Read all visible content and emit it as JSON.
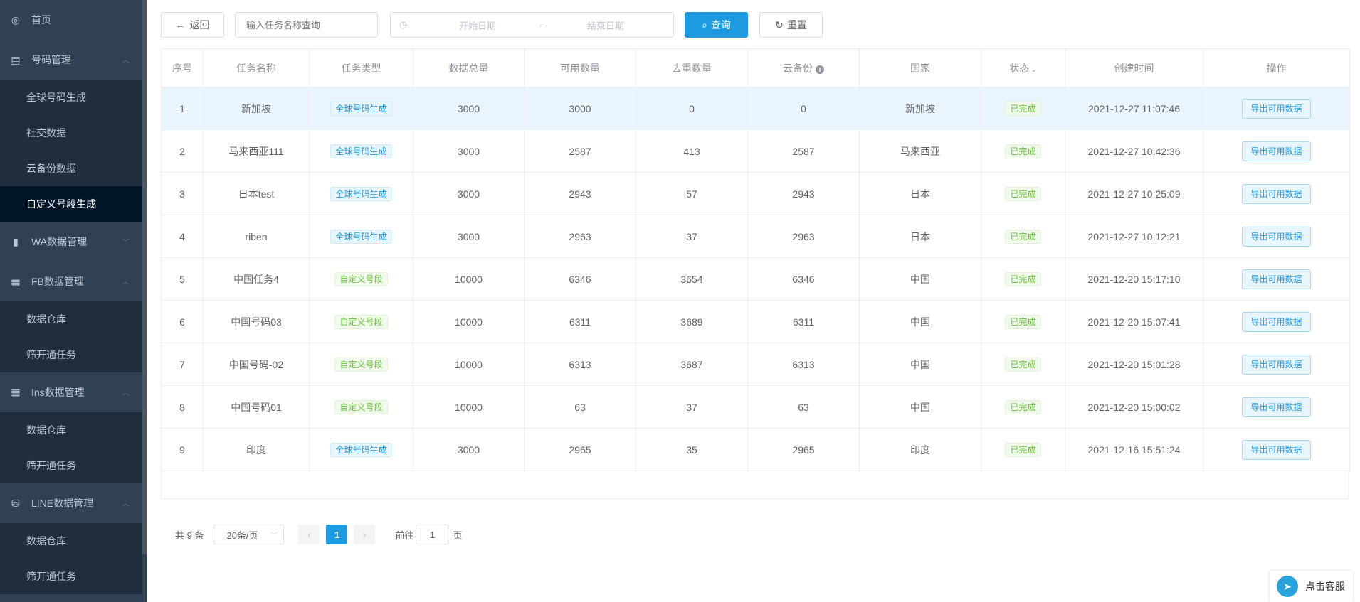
{
  "sidebar": {
    "home": "首页",
    "number_mgmt": "号码管理",
    "number_sub": [
      "全球号码生成",
      "社交数据",
      "云备份数据",
      "自定义号段生成"
    ],
    "wa_mgmt": "WA数据管理",
    "fb_mgmt": "FB数据管理",
    "fb_sub": [
      "数据仓库",
      "筛开通任务"
    ],
    "ins_mgmt": "Ins数据管理",
    "ins_sub": [
      "数据仓库",
      "筛开通任务"
    ],
    "line_mgmt": "LINE数据管理",
    "line_sub": [
      "数据仓库",
      "筛开通任务"
    ]
  },
  "toolbar": {
    "back_label": "返回",
    "search_placeholder": "输入任务名称查询",
    "start_date_placeholder": "开始日期",
    "date_separator": "-",
    "end_date_placeholder": "结束日期",
    "query_label": "查询",
    "reset_label": "重置"
  },
  "table": {
    "headers": [
      "序号",
      "任务名称",
      "任务类型",
      "数据总量",
      "可用数量",
      "去重数量",
      "云备份",
      "国家",
      "状态",
      "创建时间",
      "操作"
    ],
    "rows": [
      {
        "no": "1",
        "name": "新加坡",
        "type": "全球号码生成",
        "tcolor": "blue",
        "total": "3000",
        "avail": "3000",
        "dedup": "0",
        "cloud": "0",
        "country": "新加坡",
        "status": "已完成",
        "created": "2021-12-27 11:07:46",
        "action": "导出可用数据"
      },
      {
        "no": "2",
        "name": "马来西亚111",
        "type": "全球号码生成",
        "tcolor": "blue",
        "total": "3000",
        "avail": "2587",
        "dedup": "413",
        "cloud": "2587",
        "country": "马来西亚",
        "status": "已完成",
        "created": "2021-12-27 10:42:36",
        "action": "导出可用数据"
      },
      {
        "no": "3",
        "name": "日本test",
        "type": "全球号码生成",
        "tcolor": "blue",
        "total": "3000",
        "avail": "2943",
        "dedup": "57",
        "cloud": "2943",
        "country": "日本",
        "status": "已完成",
        "created": "2021-12-27 10:25:09",
        "action": "导出可用数据"
      },
      {
        "no": "4",
        "name": "riben",
        "type": "全球号码生成",
        "tcolor": "blue",
        "total": "3000",
        "avail": "2963",
        "dedup": "37",
        "cloud": "2963",
        "country": "日本",
        "status": "已完成",
        "created": "2021-12-27 10:12:21",
        "action": "导出可用数据"
      },
      {
        "no": "5",
        "name": "中国任务4",
        "type": "自定义号段",
        "tcolor": "green",
        "total": "10000",
        "avail": "6346",
        "dedup": "3654",
        "cloud": "6346",
        "country": "中国",
        "status": "已完成",
        "created": "2021-12-20 15:17:10",
        "action": "导出可用数据"
      },
      {
        "no": "6",
        "name": "中国号码03",
        "type": "自定义号段",
        "tcolor": "green",
        "total": "10000",
        "avail": "6311",
        "dedup": "3689",
        "cloud": "6311",
        "country": "中国",
        "status": "已完成",
        "created": "2021-12-20 15:07:41",
        "action": "导出可用数据"
      },
      {
        "no": "7",
        "name": "中国号码-02",
        "type": "自定义号段",
        "tcolor": "green",
        "total": "10000",
        "avail": "6313",
        "dedup": "3687",
        "cloud": "6313",
        "country": "中国",
        "status": "已完成",
        "created": "2021-12-20 15:01:28",
        "action": "导出可用数据"
      },
      {
        "no": "8",
        "name": "中国号码01",
        "type": "自定义号段",
        "tcolor": "green",
        "total": "10000",
        "avail": "63",
        "dedup": "37",
        "cloud": "63",
        "country": "中国",
        "status": "已完成",
        "created": "2021-12-20 15:00:02",
        "action": "导出可用数据"
      },
      {
        "no": "9",
        "name": "印度",
        "type": "全球号码生成",
        "tcolor": "blue",
        "total": "3000",
        "avail": "2965",
        "dedup": "35",
        "cloud": "2965",
        "country": "印度",
        "status": "已完成",
        "created": "2021-12-16 15:51:24",
        "action": "导出可用数据"
      }
    ]
  },
  "pagination": {
    "total": "共 9 条",
    "page_size": "20条/页",
    "current": "1",
    "goto_label": "前往",
    "goto_value": "1",
    "page_suffix": "页"
  },
  "support": {
    "label": "点击客服"
  },
  "colors": {
    "primary": "#1e9be0",
    "sidebar": "#304156",
    "success": "#67c23a"
  }
}
